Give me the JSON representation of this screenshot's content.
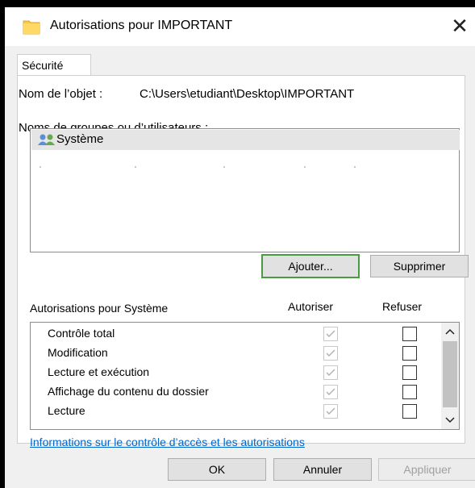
{
  "window": {
    "title": "Autorisations pour IMPORTANT",
    "close_glyph": "✕"
  },
  "tabs": [
    {
      "label": "Sécurité"
    }
  ],
  "object": {
    "label": "Nom de l’objet :",
    "path": "C:\\Users\\etudiant\\Desktop\\IMPORTANT"
  },
  "groups": {
    "label": "Noms de groupes ou d’utilisateurs :",
    "items": [
      {
        "name": "Système",
        "icon": "users-icon"
      }
    ]
  },
  "buttons": {
    "ajouter": "Ajouter...",
    "supprimer": "Supprimer",
    "ok": "OK",
    "annuler": "Annuler",
    "appliquer": "Appliquer"
  },
  "permissions": {
    "label": "Autorisations pour Système",
    "col_allow": "Autoriser",
    "col_deny": "Refuser",
    "rows": [
      {
        "name": "Contrôle total",
        "allow": true,
        "deny": false
      },
      {
        "name": "Modification",
        "allow": true,
        "deny": false
      },
      {
        "name": "Lecture et exécution",
        "allow": true,
        "deny": false
      },
      {
        "name": "Affichage du contenu du dossier",
        "allow": true,
        "deny": false
      },
      {
        "name": "Lecture",
        "allow": true,
        "deny": false
      }
    ]
  },
  "link": {
    "text": "Informations sur le contrôle d’accès et les autorisations"
  },
  "colors": {
    "accent_focus": "#4a9a3f",
    "link": "#0066cc",
    "folder": "#f6c94b"
  }
}
